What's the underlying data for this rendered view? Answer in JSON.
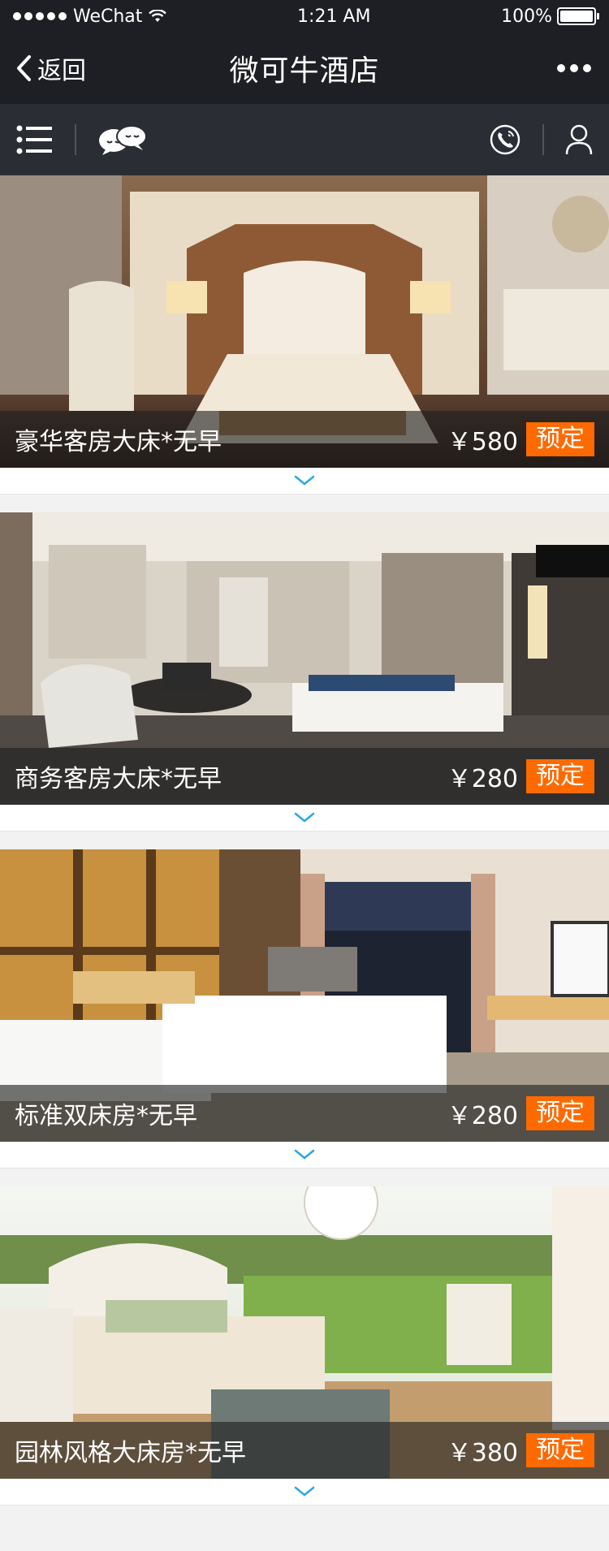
{
  "status_bar": {
    "carrier": "WeChat",
    "time": "1:21 AM",
    "battery": "100%",
    "battery_level": 1.0
  },
  "navbar": {
    "back_label": "返回",
    "title": "微可牛酒店",
    "more_icon": "more-dots-icon"
  },
  "toolbar": {
    "menu_icon": "menu-list-icon",
    "chat_icon": "chat-bubbles-icon",
    "phone_icon": "phone-icon",
    "user_icon": "user-icon"
  },
  "rooms": [
    {
      "name": "豪华客房大床*无早",
      "price": "￥580",
      "book_label": "预定"
    },
    {
      "name": "商务客房大床*无早",
      "price": "￥280",
      "book_label": "预定"
    },
    {
      "name": "标准双床房*无早",
      "price": "￥280",
      "book_label": "预定"
    },
    {
      "name": "园林风格大床房*无早",
      "price": "￥380",
      "book_label": "预定"
    }
  ],
  "colors": {
    "header_bg": "#1e1f24",
    "toolbar_bg": "#2b2d35",
    "accent": "#ff6a00",
    "chevron": "#2aa6e8"
  }
}
